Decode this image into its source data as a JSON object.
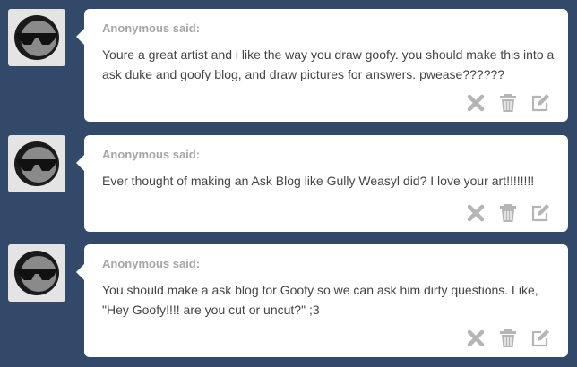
{
  "asks": [
    {
      "asker": "Anonymous said:",
      "question": "Youre a great artist and i like the way you draw goofy. you should make this into a ask duke and goofy blog, and draw pictures for answers. pwease??????"
    },
    {
      "asker": "Anonymous said:",
      "question": "Ever thought of making an Ask Blog like Gully Weasyl did? I love your art!!!!!!!!"
    },
    {
      "asker": "Anonymous said:",
      "question": "You should make a ask blog for Goofy so we can ask him dirty questions. Like, \"Hey Goofy!!!! are you cut or uncut?\" ;3"
    }
  ],
  "actions": {
    "delete_icon": "x-icon",
    "trash_icon": "trash-icon",
    "answer_icon": "edit-icon"
  },
  "colors": {
    "background": "#33496a",
    "card": "#ffffff",
    "asker_text": "#a6a6a6",
    "question_text": "#444444",
    "action_icon": "#b5b5b5"
  }
}
